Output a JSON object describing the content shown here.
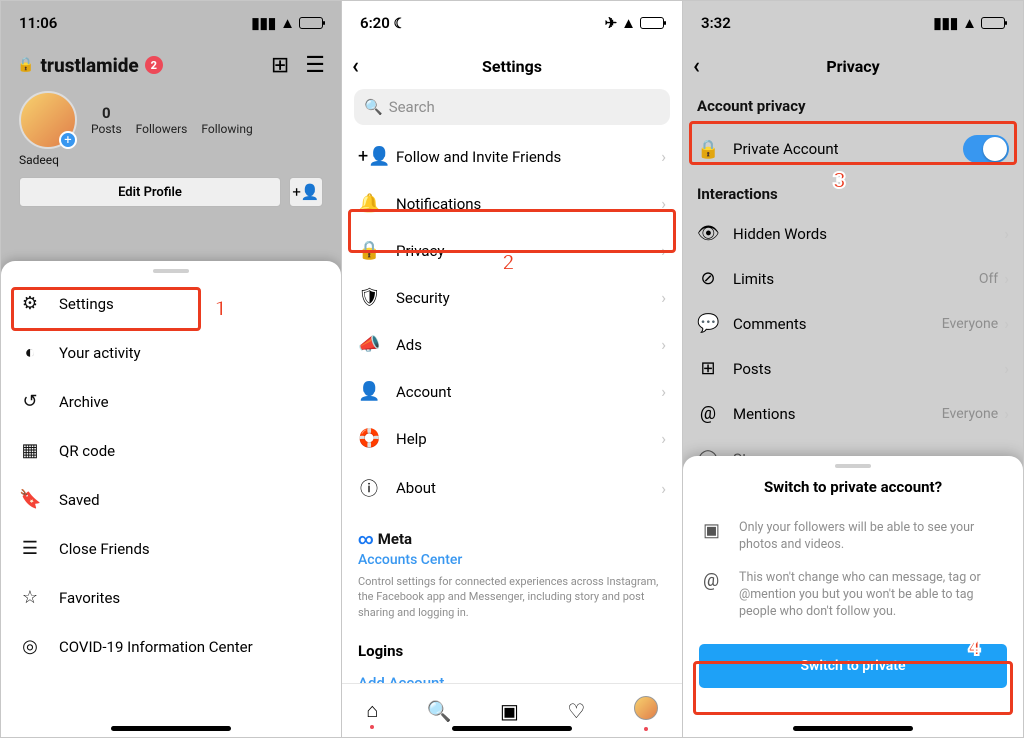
{
  "panel1": {
    "status": {
      "time": "11:06"
    },
    "username": "trustlamide",
    "notif_badge": "2",
    "display_name": "Sadeeq",
    "stats": {
      "posts_n": "0",
      "posts_l": "Posts",
      "followers_l": "Followers",
      "following_l": "Following"
    },
    "edit_profile": "Edit Profile",
    "menu": {
      "settings": "Settings",
      "activity": "Your activity",
      "archive": "Archive",
      "qr": "QR code",
      "saved": "Saved",
      "close_friends": "Close Friends",
      "favorites": "Favorites",
      "covid": "COVID-19 Information Center"
    },
    "step": "1"
  },
  "panel2": {
    "status": {
      "time": "6:20"
    },
    "title": "Settings",
    "search_placeholder": "Search",
    "items": {
      "follow": "Follow and Invite Friends",
      "notifications": "Notifications",
      "privacy": "Privacy",
      "security": "Security",
      "ads": "Ads",
      "account": "Account",
      "help": "Help",
      "about": "About"
    },
    "meta_brand": "Meta",
    "accounts_center": "Accounts Center",
    "meta_desc": "Control settings for connected experiences across Instagram, the Facebook app and Messenger, including story and post sharing and logging in.",
    "logins_header": "Logins",
    "add_account": "Add Account",
    "step": "2"
  },
  "panel3": {
    "status": {
      "time": "3:32"
    },
    "title": "Privacy",
    "section_privacy": "Account privacy",
    "private_account": "Private Account",
    "section_interactions": "Interactions",
    "rows": {
      "hidden": "Hidden Words",
      "limits": "Limits",
      "limits_val": "Off",
      "comments": "Comments",
      "comments_val": "Everyone",
      "posts": "Posts",
      "mentions": "Mentions",
      "mentions_val": "Everyone",
      "story": "Story"
    },
    "sheet": {
      "title": "Switch to private account?",
      "info1": "Only your followers will be able to see your photos and videos.",
      "info2": "This won't change who can message, tag or @mention you but you won't be able to tag people who don't follow you.",
      "button": "Switch to private"
    },
    "step_toggle": "3",
    "step_button": "4"
  }
}
